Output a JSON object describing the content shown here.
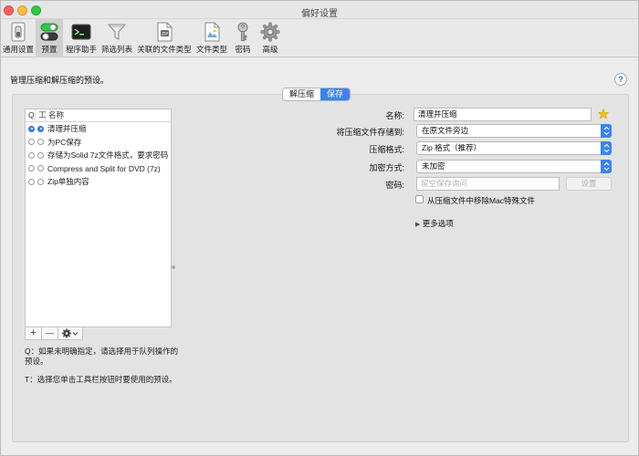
{
  "window": {
    "title": "偏好设置"
  },
  "toolbar": {
    "items": [
      {
        "label": "通用设置",
        "icon": "switch-icon"
      },
      {
        "label": "预置",
        "icon": "toggles-icon"
      },
      {
        "label": "程序助手",
        "icon": "terminal-icon"
      },
      {
        "label": "筛选列表",
        "icon": "funnel-icon"
      },
      {
        "label": "关联的文件类型",
        "icon": "zip-file-icon"
      },
      {
        "label": "文件类型",
        "icon": "document-icon"
      },
      {
        "label": "密码",
        "icon": "key-icon"
      },
      {
        "label": "高级",
        "icon": "gear-icon"
      }
    ],
    "active_index": 1
  },
  "description": "管理压缩和解压缩的预设。",
  "help_label": "?",
  "tabs": [
    {
      "label": "解压缩",
      "selected": false
    },
    {
      "label": "保存",
      "selected": true
    }
  ],
  "preset_list": {
    "headers": {
      "q": "Q",
      "w": "工",
      "name": "名称"
    },
    "rows": [
      {
        "label": "清理并压缩",
        "q_on": true,
        "w_on": true,
        "selected": true
      },
      {
        "label": "为PC保存",
        "q_on": false,
        "w_on": false,
        "selected": false
      },
      {
        "label": "存储为Solid 7z文件格式，要求密码",
        "q_on": false,
        "w_on": false,
        "selected": false
      },
      {
        "label": "Compress and Split for DVD (7z)",
        "q_on": false,
        "w_on": false,
        "selected": false
      },
      {
        "label": "Zip单独内容",
        "q_on": false,
        "w_on": false,
        "selected": false
      }
    ],
    "add_label": "+",
    "remove_label": "—"
  },
  "notes": {
    "q_note": "Q：如果未明确指定，请选择用于队列操作的预设。",
    "t_note": "T：选择您单击工具栏按钮时要使用的预设。"
  },
  "form": {
    "name_label": "名称:",
    "name_value": "清理并压缩",
    "save_to_label": "将压缩文件存储到:",
    "save_to_value": "在原文件旁边",
    "format_label": "压缩格式:",
    "format_value": "Zip 格式（推荐）",
    "encryption_label": "加密方式:",
    "encryption_value": "未加密",
    "password_label": "密码:",
    "password_placeholder": "留空保存询问",
    "set_button": "设置",
    "remove_mac_files_label": "从压缩文件中移除Mac特殊文件",
    "remove_mac_files_checked": false,
    "more_options_label": "更多选项"
  },
  "colors": {
    "accent": "#3a82f7",
    "star": "#f5c518"
  }
}
